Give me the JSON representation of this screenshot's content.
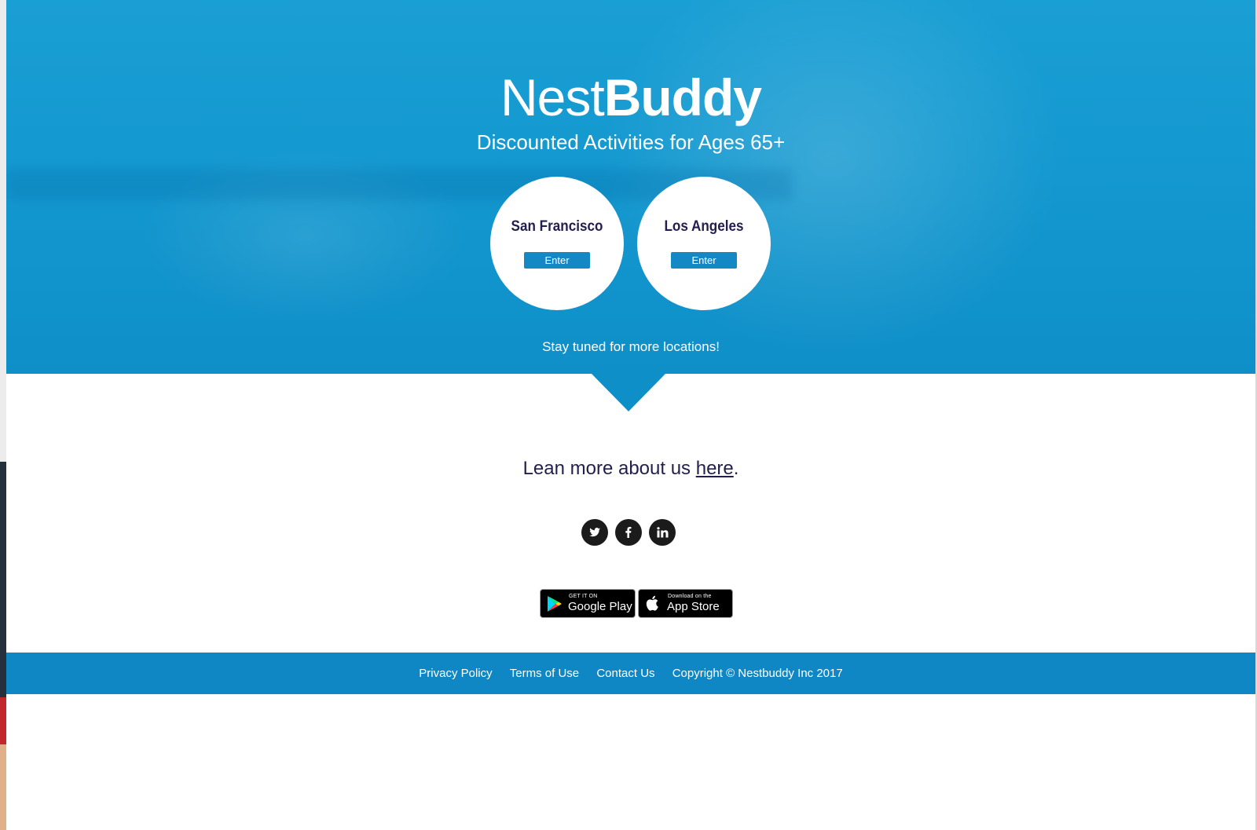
{
  "hero": {
    "brand_light": "Nest",
    "brand_bold": "Buddy",
    "tagline": "Discounted Activities for Ages 65+",
    "cities": [
      {
        "name": "San Francisco",
        "button": "Enter"
      },
      {
        "name": "Los Angeles",
        "button": "Enter"
      }
    ],
    "stay_tuned": "Stay tuned for more locations!"
  },
  "learn": {
    "prefix": "Lean more about us ",
    "link": "here",
    "suffix": "."
  },
  "social": {
    "icons": [
      "twitter-icon",
      "facebook-icon",
      "linkedin-icon"
    ]
  },
  "stores": {
    "google_small": "GET IT ON",
    "google_large": "Google Play",
    "apple_small": "Download on the",
    "apple_large": "App Store"
  },
  "footer": {
    "privacy": "Privacy Policy",
    "terms": "Terms of Use",
    "contact": "Contact Us",
    "copyright": "Copyright © Nestbuddy Inc 2017"
  },
  "colors": {
    "hero_blue": "#1499d0",
    "footer_blue": "#0f87c5",
    "button_blue": "#1488c4",
    "navy_text": "#221f4e"
  }
}
